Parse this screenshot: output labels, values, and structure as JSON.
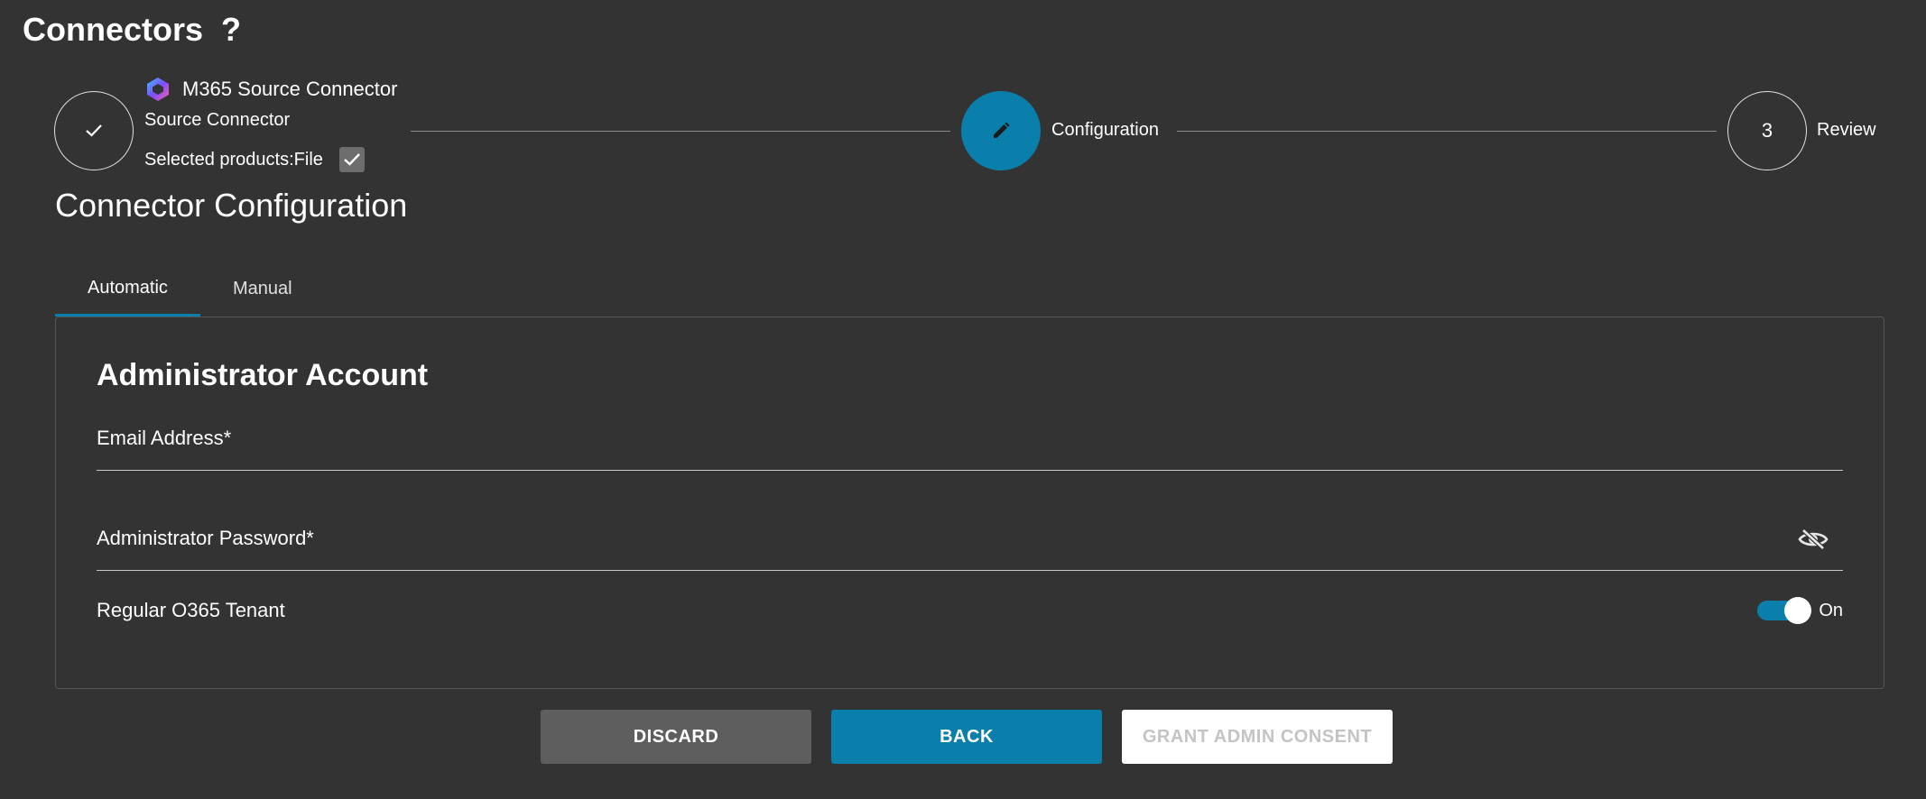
{
  "page": {
    "title": "Connectors",
    "help_label": "?"
  },
  "stepper": {
    "step1": {
      "product_name": "M365 Source Connector",
      "subtitle": "Source Connector",
      "selected_label": "Selected products:",
      "selected_value": "File",
      "product_icon": "m365-icon",
      "status_icon": "check-icon"
    },
    "step2": {
      "label": "Configuration",
      "status_icon": "pencil-icon"
    },
    "step3": {
      "number": "3",
      "label": "Review"
    }
  },
  "section": {
    "title": "Connector Configuration"
  },
  "tabs": [
    {
      "label": "Automatic",
      "active": true
    },
    {
      "label": "Manual",
      "active": false
    }
  ],
  "form": {
    "card_title": "Administrator Account",
    "email_label": "Email Address*",
    "email_value": "",
    "password_label": "Administrator Password*",
    "password_value": "",
    "password_visibility_icon": "eye-off-icon",
    "tenant_label": "Regular O365 Tenant",
    "tenant_toggle_state": "On"
  },
  "actions": {
    "discard_label": "DISCARD",
    "back_label": "BACK",
    "grant_label": "GRANT ADMIN CONSENT"
  },
  "colors": {
    "background": "#333333",
    "accent": "#0a7fab",
    "discard_bg": "#5e5e5e",
    "grant_bg": "#ffffff"
  }
}
